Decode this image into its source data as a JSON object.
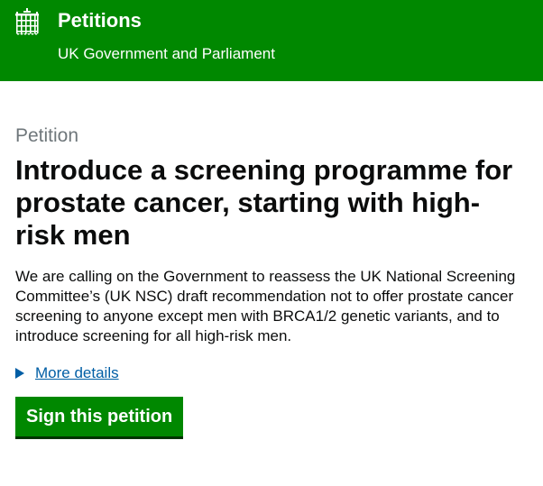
{
  "header": {
    "logo_icon": "portcullis-icon",
    "title": "Petitions",
    "subtitle": "UK Government and Parliament",
    "background_color": "#008800"
  },
  "petition": {
    "caption": "Petition",
    "title": "Introduce a screening programme for prostate cancer, starting with high-risk men",
    "summary": "We are calling on the Government to reassess the UK National Screening Committee’s (UK NSC) draft recommendation not to offer prostate cancer screening to anyone except men with BRCA1/2 genetic variants, and to introduce screening for all high-risk men.",
    "details_label": "More details",
    "details_icon": "triangle-right-icon",
    "sign_button_label": "Sign this petition"
  },
  "colors": {
    "brand_green": "#008800",
    "link_blue": "#005ea5",
    "caption_grey": "#6f777b",
    "text": "#0b0c0c"
  }
}
